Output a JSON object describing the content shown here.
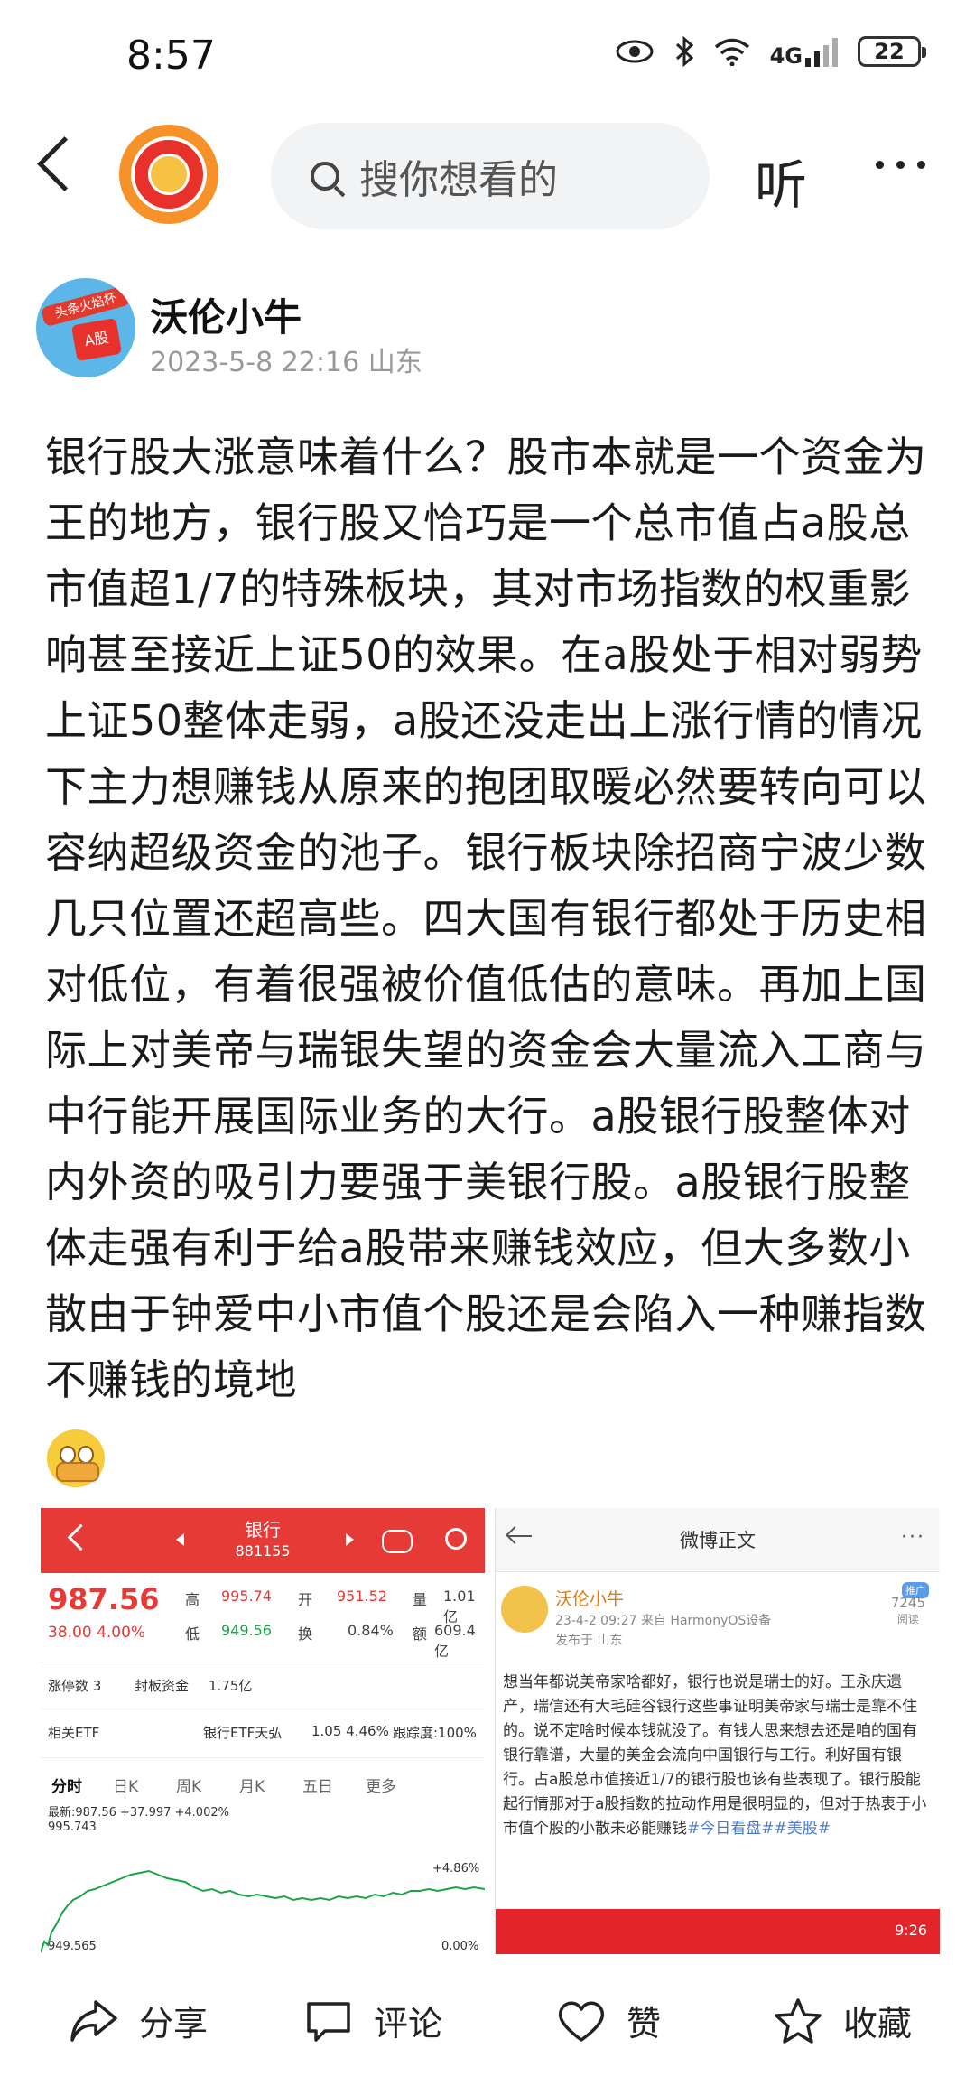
{
  "status_bar": {
    "time": "8:57",
    "network": "4G",
    "battery": "22"
  },
  "nav": {
    "search_placeholder": "搜你想看的",
    "listen_label": "听"
  },
  "author": {
    "name": "沃伦小牛",
    "meta": "2023-5-8 22:16  山东",
    "avatar_text_top": "头条火焰杯",
    "avatar_card": "A股"
  },
  "post": {
    "text": "银行股大涨意味着什么？股市本就是一个资金为王的地方，银行股又恰巧是一个总市值占a股总市值超1/7的特殊板块，其对市场指数的权重影响甚至接近上证50的效果。在a股处于相对弱势上证50整体走弱，a股还没走出上涨行情的情况下主力想赚钱从原来的抱团取暖必然要转向可以容纳超级资金的池子。银行板块除招商宁波少数几只位置还超高些。四大国有银行都处于历史相对低位，有着很强被价值低估的意味。再加上国际上对美帝与瑞银失望的资金会大量流入工商与中行能开展国际业务的大行。a股银行股整体对内外资的吸引力要强于美银行股。a股银行股整体走强有利于给a股带来赚钱效应，但大多数小散由于钟爱中小市值个股还是会陷入一种赚指数不赚钱的境地"
  },
  "stock_image": {
    "title": "银行",
    "code": "881155",
    "price": "987.56",
    "change": "38.00  4.00%",
    "high_label": "高",
    "high": "995.74",
    "open_label": "开",
    "open": "951.52",
    "volume_label": "量",
    "volume": "1.01亿",
    "low_label": "低",
    "low": "949.56",
    "turnover_label": "换",
    "turnover": "0.84%",
    "amount_label": "额",
    "amount": "609.4亿",
    "limit_up": "涨停数  3",
    "seal_label": "封板资金",
    "seal_value": "1.75亿",
    "related_etf": "相关ETF",
    "etf_name": "银行ETF天弘",
    "etf_value": "1.05  4.46%",
    "track_label": "跟踪度:100%",
    "tabs": [
      "分时",
      "日K",
      "周K",
      "月K",
      "五日",
      "更多"
    ],
    "latest": "最新:987.56  +37.997  +4.002%",
    "axis_top": "995.743",
    "axis_bottom": "949.565",
    "pct_top": "+4.86%",
    "pct_bottom": "0.00%"
  },
  "weibo_image": {
    "title": "微博正文",
    "name": "沃伦小牛",
    "time": "23-4-2 09:27  来自 HarmonyOS设备",
    "location": "发布于 山东",
    "reads": "7245",
    "reads_label": "阅读",
    "tag": "推广",
    "text": "想当年都说美帝家啥都好，银行也说是瑞士的好。王永庆遗产，瑞信还有大毛硅谷银行这些事证明美帝家与瑞士是靠不住的。说不定啥时候本钱就没了。有钱人思来想去还是咱的国有银行靠谱，大量的美金会流向中国银行与工行。利好国有银行。占a股总市值接近1/7的银行股也该有些表现了。银行股能起行情那对于a股指数的拉动作用是很明显的，但对于热衷于小市值个股的小散未必能赚钱",
    "hashtags": "#今日看盘##美股#",
    "bar_time": "9:26"
  },
  "actions": {
    "share": "分享",
    "comment": "评论",
    "like": "赞",
    "favorite": "收藏"
  },
  "colors": {
    "stock_red": "#e53a35",
    "stock_green": "#1aa34a",
    "weibo_orange": "#e07a14",
    "brand_orange": "#f7922a"
  }
}
